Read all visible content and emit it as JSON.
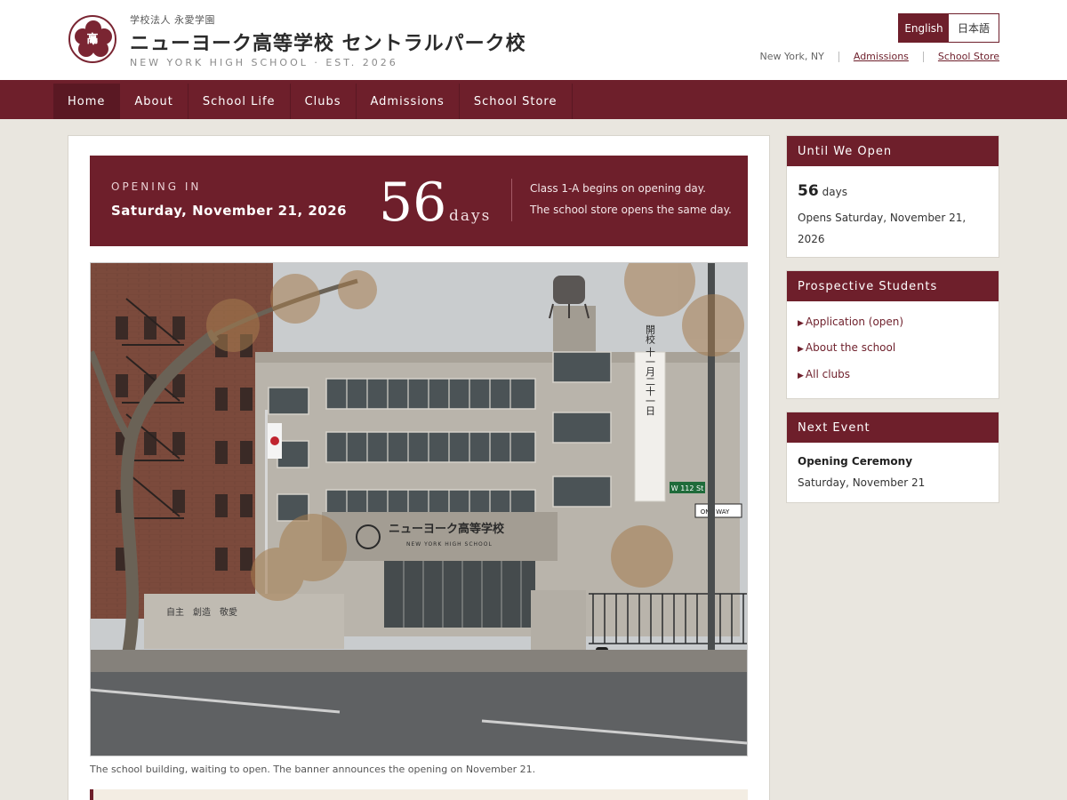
{
  "header": {
    "corp_name": "学校法人 永愛学園",
    "title": "ニューヨーク高等学校 セントラルパーク校",
    "subtitle": "NEW YORK HIGH SCHOOL · EST. 2026",
    "crest_char": "高",
    "lang": {
      "english": "English",
      "japanese": "日本語",
      "selected": "English"
    },
    "location": "New York, NY",
    "links": {
      "admissions": "Admissions",
      "store": "School Store"
    }
  },
  "nav": {
    "items": [
      "Home",
      "About",
      "School Life",
      "Clubs",
      "Admissions",
      "School Store"
    ],
    "active": "Home"
  },
  "countdown": {
    "label": "OPENING IN",
    "date": "Saturday, November 21, 2026",
    "number": "56",
    "unit": "days",
    "note1": "Class 1-A begins on opening day.",
    "note2": "The school store opens the same day."
  },
  "photo": {
    "caption": "The school building, waiting to open. The banner announces the opening on November 21.",
    "building_sign": "ニューヨーク高等学校",
    "building_sign_en": "NEW YORK HIGH SCHOOL",
    "banner": "開校 十一月二十一日",
    "street_sign": "W 112 St",
    "oneway_sign": "ONE WAY",
    "wall_text": "自主　創造　敬愛"
  },
  "sidebar": {
    "until": {
      "heading": "Until We Open",
      "number": "56",
      "unit": "days",
      "opens": "Opens Saturday, November 21, 2026"
    },
    "prospective": {
      "heading": "Prospective Students",
      "links": [
        "Application (open)",
        "About the school",
        "All clubs"
      ]
    },
    "event": {
      "heading": "Next Event",
      "title": "Opening Ceremony",
      "date": "Saturday, November 21"
    }
  },
  "colors": {
    "brand": "#6e1f2b",
    "background": "#e9e6df"
  },
  "icons": {
    "crest": "sakura-crest-icon",
    "link_marker": "triangle-right-icon"
  }
}
